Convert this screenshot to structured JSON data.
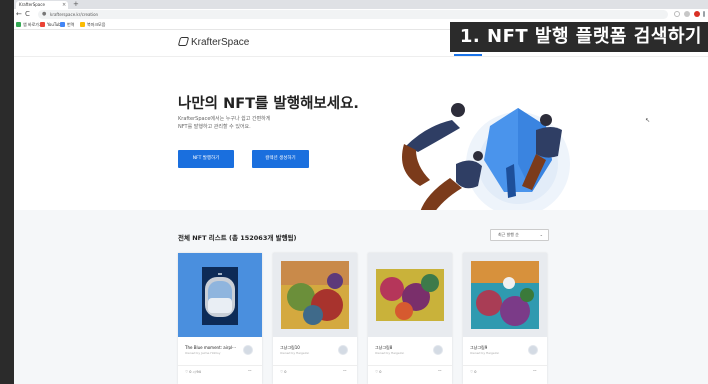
{
  "browser": {
    "tab_title": "KrafterSpace",
    "tab_close": "×",
    "new_tab": "+",
    "nav_back": "←",
    "nav_forward": "→",
    "nav_reload": "C",
    "nav_home": "⌂",
    "lock": "🔒",
    "url": "krafterspace.kr/creation",
    "bookmarks": [
      {
        "label": "앱 바로가기",
        "color": "#34a853"
      },
      {
        "label": "YouTube",
        "color": "#ea4335"
      },
      {
        "label": "번역",
        "color": "#4285f4"
      },
      {
        "label": "북마크모음",
        "color": "#fbbc04"
      }
    ]
  },
  "header": {
    "logo_text": "KrafterSpace"
  },
  "overlay": {
    "caption": "1. NFT 발행 플랫폼 검색하기"
  },
  "hero": {
    "title": "나만의 NFT를 발행해보세요.",
    "desc_line1": "KrafterSpace에서는 누구나 쉽고 간편하게",
    "desc_line2": "NFT를 발행하고 관리할 수 있어요.",
    "btn_primary": "NFT 발행하기",
    "btn_secondary": "컬렉션 생성하기"
  },
  "list": {
    "title": "전체 NFT 리스트 (총 152063개 발행됨)",
    "sort_label": "최근 발행 순",
    "sort_chevron": "⌄",
    "cards": [
      {
        "name": "The Blue moment: airpl···",
        "owner": "Owned by Jaime Hohlsy",
        "likes": "♡ 0   ◁ 94",
        "more": "···"
      },
      {
        "name": "그냥그림10",
        "owner": "Owned by Heigelon",
        "likes": "♡ 0",
        "more": "···"
      },
      {
        "name": "그냥그림8",
        "owner": "Owned by Heigelon",
        "likes": "♡ 0",
        "more": "···"
      },
      {
        "name": "그냥그림9",
        "owner": "Owned by Heigelon",
        "likes": "♡ 0",
        "more": "···"
      }
    ]
  },
  "colors": {
    "accent": "#1a6fde",
    "illustration_blue": "#3d8ff0",
    "figure_brown": "#7b3b1b"
  }
}
